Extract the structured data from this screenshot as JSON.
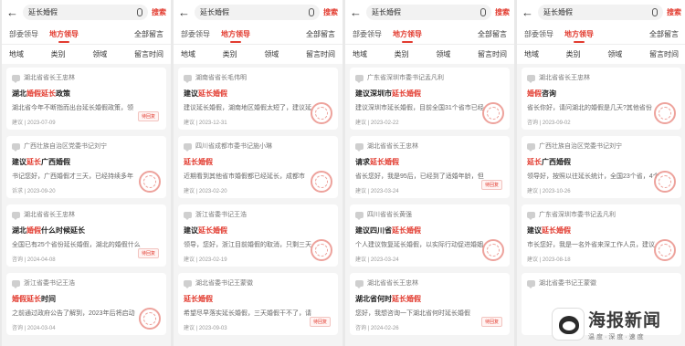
{
  "panels": [
    {
      "search_query": "延长婚假",
      "search_button": "搜索",
      "tabs": [
        "部委领导",
        "地方领导",
        "全部留言"
      ],
      "filters": [
        "地域",
        "类别",
        "领域",
        "留言时间"
      ],
      "cards": [
        {
          "recipient": "湖北省省长王忠林",
          "title_pre": "湖北",
          "title_hl": "婚假延长",
          "title_post": "政策",
          "body": "湖北省今年不断指而出台延长婚假政策，领",
          "meta": "建议 | 2023-07-09",
          "status": "待回复",
          "seal": false
        },
        {
          "recipient": "广西壮族自治区党委书记刘宁",
          "title_pre": "建议",
          "title_hl": "延长",
          "title_post": "广西婚假",
          "body": "书记您好，广西婚假才三天，已经持续多年",
          "meta": "诉求 | 2023-09-20",
          "status": "",
          "seal": true
        },
        {
          "recipient": "湖北省省长王忠林",
          "title_pre": "湖北",
          "title_hl": "婚假",
          "title_post": "什么时候延长",
          "body": "全国已有25个省份延长婚假，湖北的婚假什么",
          "meta": "咨询 | 2024-04-08",
          "status": "待回复",
          "seal": false
        },
        {
          "recipient": "浙江省委书记王浩",
          "title_pre": "",
          "title_hl": "婚假延长",
          "title_post": "时间",
          "body": "之前通过政府公告了解到，2023年后将启动",
          "meta": "咨询 | 2024-03-04",
          "status": "",
          "seal": true
        }
      ]
    },
    {
      "search_query": "延长婚假",
      "search_button": "搜索",
      "tabs": [
        "部委领导",
        "地方领导",
        "全部留言"
      ],
      "filters": [
        "地域",
        "类别",
        "领域",
        "留言时间"
      ],
      "cards": [
        {
          "recipient": "湖南省省长毛伟明",
          "title_pre": "建议",
          "title_hl": "延长婚假",
          "title_post": "",
          "body": "建议延长婚假，湖南地区婚假太短了，建议延",
          "meta": "建议 | 2023-12-31",
          "status": "",
          "seal": true
        },
        {
          "recipient": "四川省成都市委书记施小琳",
          "title_pre": "",
          "title_hl": "延长婚假",
          "title_post": "",
          "body": "近期看到其他省市婚假都已经延长，成都市",
          "meta": "建议 | 2023-02-20",
          "status": "",
          "seal": true
        },
        {
          "recipient": "浙江省委书记王浩",
          "title_pre": "建议",
          "title_hl": "延长婚假",
          "title_post": "",
          "body": "领导，您好，浙江目前婚假的取消，只剩三天",
          "meta": "建议 | 2023-02-19",
          "status": "",
          "seal": true
        },
        {
          "recipient": "湖北省委书记王蒙徽",
          "title_pre": "",
          "title_hl": "延长婚假",
          "title_post": "",
          "body": "希望尽早落实延长婚假，三天婚假干不了，请",
          "meta": "建议 | 2023-09-03",
          "status": "待回复",
          "seal": false
        }
      ]
    },
    {
      "search_query": "延长婚假",
      "search_button": "搜索",
      "tabs": [
        "部委领导",
        "地方领导",
        "全部留言"
      ],
      "filters": [
        "地域",
        "类别",
        "领域",
        "留言时间"
      ],
      "cards": [
        {
          "recipient": "广东省深圳市委书记孟凡利",
          "title_pre": "建议深圳市",
          "title_hl": "延长婚假",
          "title_post": "",
          "body": "建议深圳市延长婚假，目前全国31个省市已经",
          "meta": "建议 | 2023-02-22",
          "status": "",
          "seal": true
        },
        {
          "recipient": "湖北省省长王忠林",
          "title_pre": "请求",
          "title_hl": "延长婚假",
          "title_post": "",
          "body": "省长您好，我是95后，已经到了适婚年龄，但",
          "meta": "建议 | 2023-03-24",
          "status": "待回复",
          "seal": false
        },
        {
          "recipient": "四川省省长黄强",
          "title_pre": "建议四川省",
          "title_hl": "延长婚假",
          "title_post": "",
          "body": "个人建议恢复延长婚假，以实际行动促进婚姻",
          "meta": "建议 | 2023-03-24",
          "status": "",
          "seal": true
        },
        {
          "recipient": "湖北省省长王忠林",
          "title_pre": "湖北省何时",
          "title_hl": "延长婚假",
          "title_post": "",
          "body": "您好，我想咨询一下湖北省何时延长婚假",
          "meta": "咨询 | 2024-02-26",
          "status": "待回复",
          "seal": false
        }
      ]
    },
    {
      "search_query": "延长婚假",
      "search_button": "搜索",
      "tabs": [
        "部委领导",
        "地方领导",
        "全部留言"
      ],
      "filters": [
        "地域",
        "类别",
        "领域",
        "留言时间"
      ],
      "cards": [
        {
          "recipient": "湖北省省长王忠林",
          "title_pre": "",
          "title_hl": "婚假",
          "title_post": "咨询",
          "body": "省长你好，请问湖北的婚假是几天?其他省份",
          "meta": "咨询 | 2023-09-02",
          "status": "",
          "seal": true
        },
        {
          "recipient": "广西壮族自治区党委书记刘宁",
          "title_pre": "",
          "title_hl": "延长",
          "title_post": "广西婚假",
          "body": "领导好，按照以往延长统计，全国23个省，4个",
          "meta": "建议 | 2023-10-26",
          "status": "",
          "seal": true
        },
        {
          "recipient": "广东省深圳市委书记孟凡利",
          "title_pre": "建议",
          "title_hl": "延长婚假",
          "title_post": "",
          "body": "市长您好，我是一名外省来深工作人员，建议",
          "meta": "建议 | 2023-08-18",
          "status": "",
          "seal": true
        },
        {
          "recipient": "湖北省委书记王蒙徽",
          "title_pre": "",
          "title_hl": "",
          "title_post": "",
          "body": "",
          "meta": "",
          "status": "",
          "seal": false
        }
      ]
    }
  ],
  "watermark": {
    "title": "海报新闻",
    "subtitle": "温度·深度·速度"
  }
}
